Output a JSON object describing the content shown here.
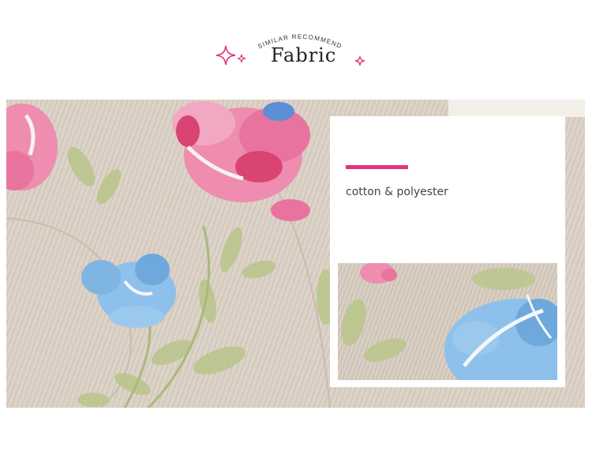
{
  "header": {
    "subtitle": "SIMILAR  RECOMMEND",
    "title": "Fabric"
  },
  "card": {
    "material": "cotton & polyester"
  },
  "colors": {
    "accent": "#e0357a",
    "fabric_base": "#ddd3c8",
    "flower_pink": "#e9739f",
    "flower_blue": "#7fb5e3",
    "leaf_green": "#a9b97e"
  },
  "icons": [
    "sparkle-icon",
    "sparkle-small-icon"
  ]
}
